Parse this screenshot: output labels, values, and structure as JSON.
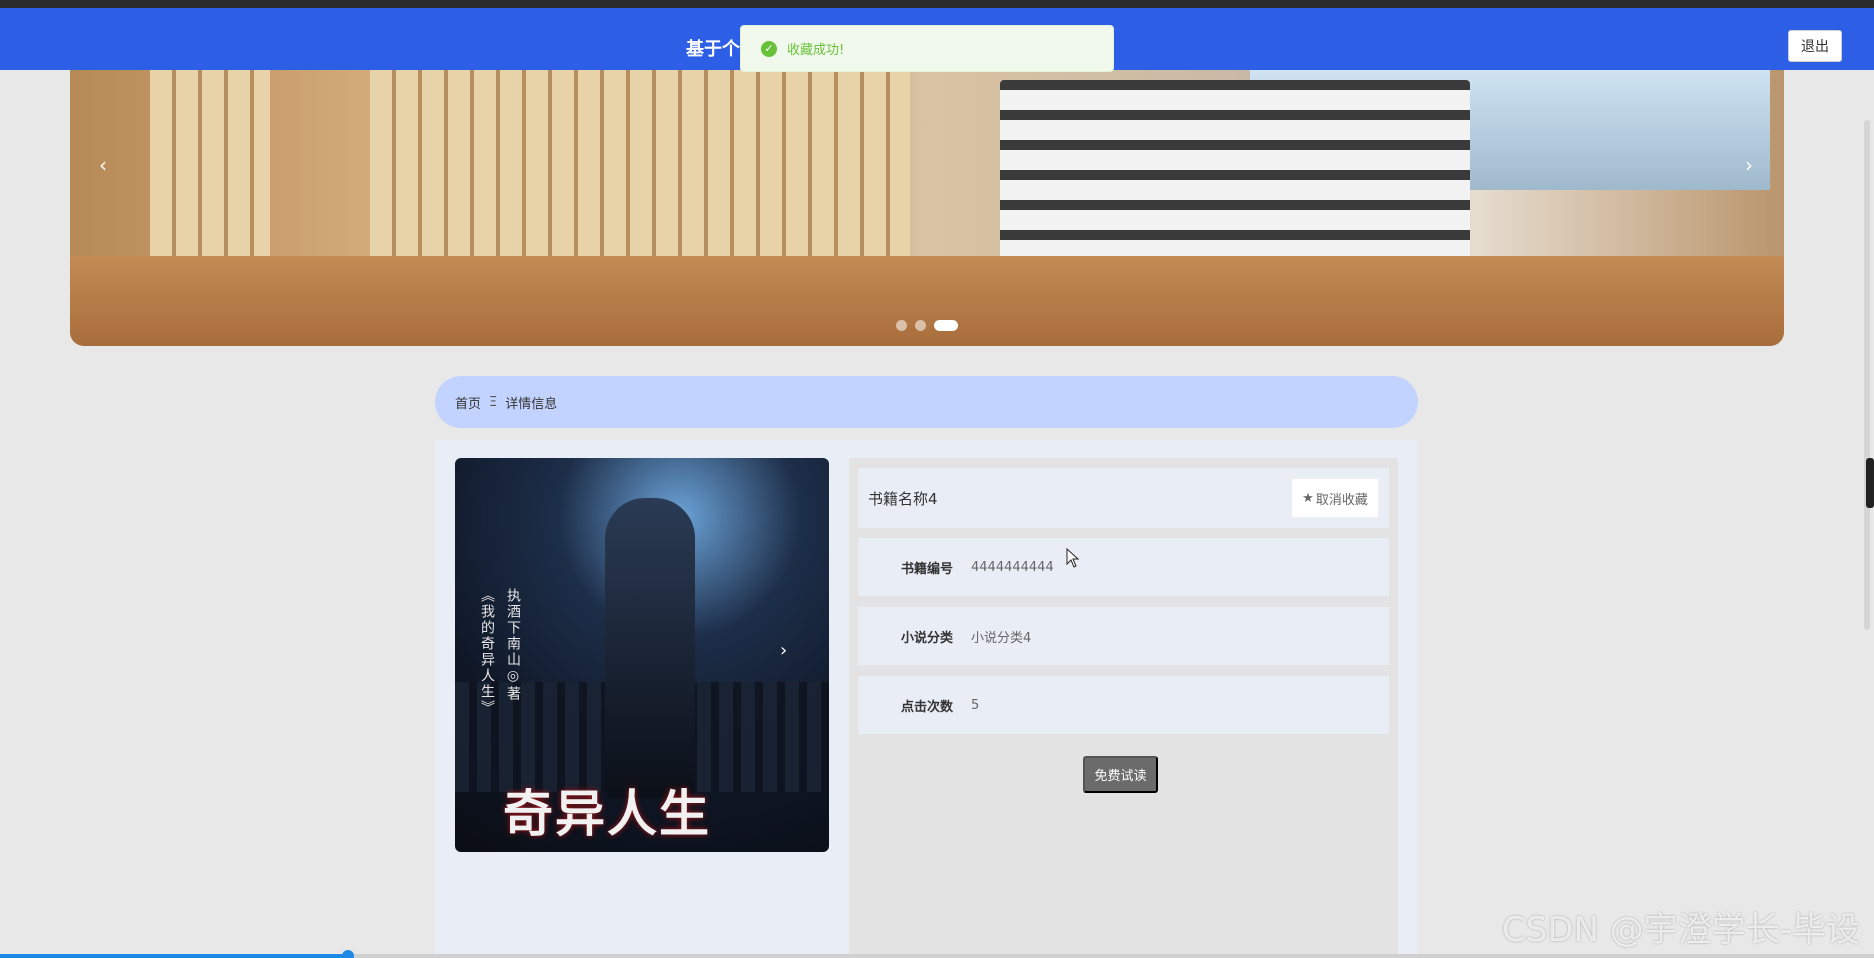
{
  "header": {
    "site_title": "基于个",
    "user_hint": "",
    "logout_label": "退出"
  },
  "toast": {
    "message": "收藏成功!",
    "status_color": "#67c23a"
  },
  "banner": {
    "prev_arrow": "‹",
    "next_arrow": "›",
    "slides_total": 3,
    "active_slide": 3
  },
  "breadcrumb": {
    "home": "首页",
    "separator": "Ξ",
    "current": "详情信息"
  },
  "book": {
    "name": "书籍名称4",
    "favorite_label": "取消收藏",
    "cover_title": "奇异人生",
    "cover_series": "《我的奇异人生》",
    "cover_author": "执酒下南山◎著",
    "cover_next_arrow": "›",
    "fields": [
      {
        "label": "书籍编号",
        "value": "4444444444"
      },
      {
        "label": "小说分类",
        "value": "小说分类4"
      },
      {
        "label": "点击次数",
        "value": "5"
      }
    ],
    "read_button": "免费试读"
  },
  "watermark": "CSDN @宇澄学长-毕设",
  "colors": {
    "header": "#2d5ee6",
    "breadcrumb_bg": "#c3d3ff",
    "read_button": "#6b6b6b"
  },
  "icons": {
    "toast": "check-circle-icon",
    "favorite": "star-icon",
    "cursor": "mouse-pointer-icon"
  }
}
